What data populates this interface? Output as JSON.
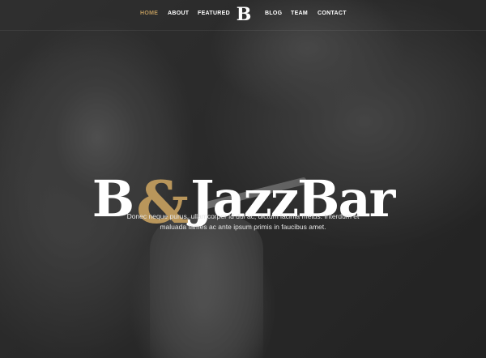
{
  "navbar": {
    "items": [
      {
        "label": "HOME",
        "active": true
      },
      {
        "label": "ABOUT",
        "active": false
      },
      {
        "label": "FEATURED",
        "active": false
      },
      {
        "label": "BLOG",
        "active": false
      },
      {
        "label": "TEAM",
        "active": false
      },
      {
        "label": "CONTACT",
        "active": false
      }
    ],
    "logo": "B"
  },
  "hero": {
    "title_part1": "B",
    "title_amp": "&",
    "title_part2": "JazzBar",
    "description": "Donec neque purus, ullamcorper id dui ac, dictum lacinia metus. Interdum et maluada fames ac ante ipsum primis in faucibus amet."
  },
  "colors": {
    "accent": "#b9965b",
    "text": "#ffffff",
    "background": "#2c2c2c"
  },
  "icons": {
    "logo": "letter-b-logo"
  }
}
